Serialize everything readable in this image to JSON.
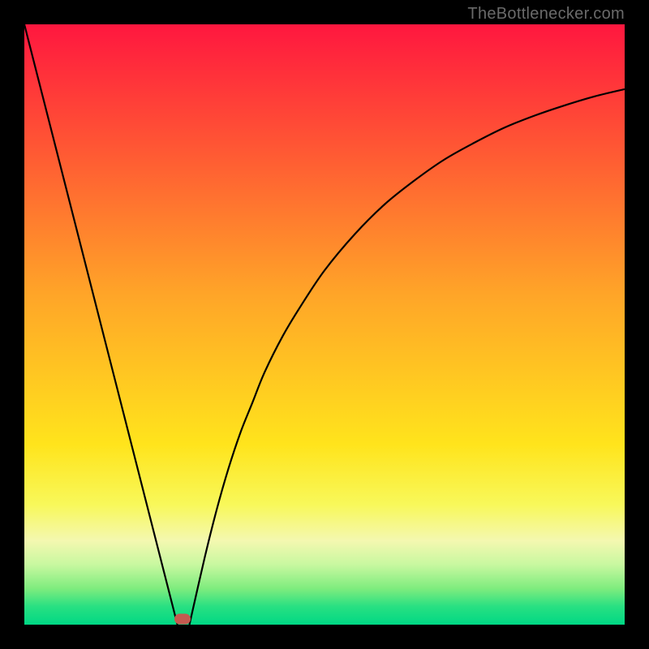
{
  "attribution": "TheBottlenecker.com",
  "marker_color": "#c45a50",
  "chart_data": {
    "type": "line",
    "title": "",
    "xlabel": "",
    "ylabel": "",
    "xlim": [
      0,
      100
    ],
    "ylim": [
      0,
      100
    ],
    "gradient_stops": [
      {
        "offset": 0,
        "color": "#ff173f"
      },
      {
        "offset": 0.2,
        "color": "#ff5534"
      },
      {
        "offset": 0.45,
        "color": "#ffa528"
      },
      {
        "offset": 0.7,
        "color": "#ffe41c"
      },
      {
        "offset": 0.8,
        "color": "#f8f85a"
      },
      {
        "offset": 0.86,
        "color": "#f4f8b0"
      },
      {
        "offset": 0.9,
        "color": "#c8f8a0"
      },
      {
        "offset": 0.94,
        "color": "#7eec7e"
      },
      {
        "offset": 0.97,
        "color": "#28e082"
      },
      {
        "offset": 1.0,
        "color": "#00d884"
      }
    ],
    "series": [
      {
        "name": "left-line",
        "x": [
          0,
          25.5
        ],
        "y": [
          100,
          0
        ]
      },
      {
        "name": "right-curve",
        "x": [
          27.5,
          30,
          32,
          34,
          36,
          38,
          40,
          43,
          46,
          50,
          55,
          60,
          65,
          70,
          75,
          80,
          85,
          90,
          95,
          100
        ],
        "y": [
          0,
          11,
          19,
          26,
          32,
          37,
          42,
          48,
          53,
          59,
          65,
          70,
          74,
          77.5,
          80.3,
          82.8,
          84.8,
          86.5,
          88,
          89.2
        ]
      }
    ],
    "marker": {
      "x": 26.3,
      "y": 0.9
    }
  }
}
